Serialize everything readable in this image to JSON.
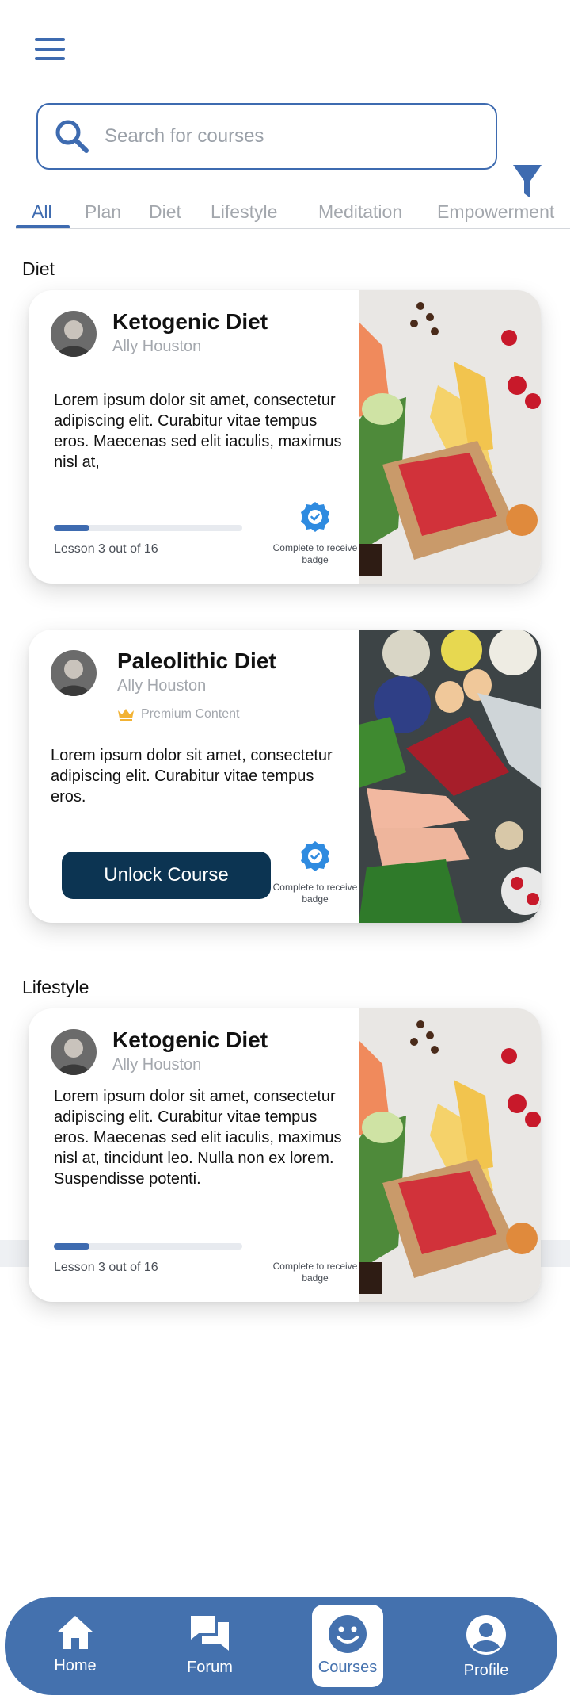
{
  "search": {
    "placeholder": "Search for courses"
  },
  "tabs": [
    "All",
    "Plan",
    "Diet",
    "Lifestyle",
    "Meditation",
    "Empowerment"
  ],
  "active_tab": "All",
  "sections": {
    "diet": {
      "title": "Diet",
      "cards": [
        {
          "title": "Ketogenic Diet",
          "author": "Ally Houston",
          "description": "Lorem ipsum dolor sit amet, consectetur adipiscing elit. Curabitur vitae tempus eros. Maecenas sed elit iaculis, maximus nisl at,",
          "progress": 0.1875,
          "lesson_text": "Lesson 3 out of 16",
          "badge_text": "Complete to receive badge"
        },
        {
          "title": "Paleolithic Diet",
          "author": "Ally Houston",
          "premium_label": "Premium Content",
          "description": "Lorem ipsum dolor sit amet, consectetur adipiscing elit. Curabitur vitae tempus eros.",
          "button_label": "Unlock Course",
          "badge_text": "Complete to receive badge"
        }
      ]
    },
    "lifestyle": {
      "title": "Lifestyle",
      "cards": [
        {
          "title": "Ketogenic Diet",
          "author": "Ally Houston",
          "description": "Lorem ipsum dolor sit amet, consectetur adipiscing elit. Curabitur vitae tempus eros. Maecenas sed elit iaculis, maximus nisl at, tincidunt leo. Nulla non ex lorem. Suspendisse potenti.",
          "progress": 0.1875,
          "lesson_text": "Lesson 3 out of 16",
          "badge_text": "Complete to receive badge"
        }
      ]
    }
  },
  "nav": [
    {
      "label": "Home",
      "icon": "home-icon"
    },
    {
      "label": "Forum",
      "icon": "forum-icon"
    },
    {
      "label": "Courses",
      "icon": "courses-icon",
      "active": true
    },
    {
      "label": "Profile",
      "icon": "profile-icon"
    }
  ],
  "colors": {
    "accent": "#3e6bb0",
    "nav_background": "#4471ae",
    "button_dark": "#0c3452",
    "badge_blue": "#2f8be0",
    "premium_gold": "#f2b233"
  }
}
